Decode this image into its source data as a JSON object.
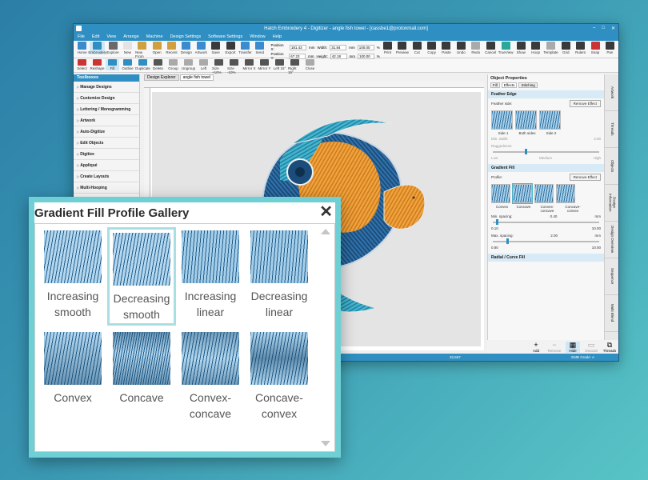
{
  "window": {
    "title": "Hatch Embroidery 4 - Digitizer - angle fish towel - [cassbe1@protonmail.com]"
  },
  "menu": [
    "File",
    "Edit",
    "View",
    "Arrange",
    "Machine",
    "Design Settings",
    "Software Settings",
    "Window",
    "Help"
  ],
  "ribbon": {
    "top_buttons": [
      "Home",
      "Embroidery",
      "Explore",
      "New",
      "New From",
      "Open",
      "Recent",
      "Design",
      "Artwork",
      "Save",
      "Export",
      "Transfer",
      "Send",
      "Print",
      "Preview",
      "Cut",
      "Copy",
      "Paste",
      "Undo",
      "Redo",
      "Cancel",
      "TrueView",
      "Show",
      "Hoop",
      "Template",
      "Grid",
      "Rulers",
      "Snap",
      "Pan"
    ],
    "bottom_buttons": [
      "Select",
      "Reshape",
      "Fill",
      "Outline",
      "Duplicate",
      "Delete",
      "Group",
      "Ungroup",
      "Left",
      "Size +10%",
      "Size -10%",
      "Mirror X",
      "Mirror Y",
      "Left 15°",
      "Right 15°",
      "Close"
    ],
    "position_x_label": "Position X:",
    "position_x": "181.43",
    "position_y_label": "Position Y:",
    "position_y": "67.23",
    "width_label": "Width:",
    "width": "31.84",
    "height_label": "Height:",
    "height": "42.18",
    "pct_w": "100.00",
    "pct_h": "100.00",
    "unit": "mm",
    "pct_unit": "%"
  },
  "tabs": [
    "Design Explorer",
    "angle fish towel"
  ],
  "toolbox": {
    "title": "Toolboxes",
    "items": [
      "Manage Designs",
      "Customize Design",
      "Lettering / Monogramming",
      "Artwork",
      "Auto-Digitize",
      "Edit Objects",
      "Digitize",
      "Appliqué",
      "Create Layouts",
      "Multi-Hooping"
    ]
  },
  "properties": {
    "title": "Object Properties",
    "tabs": [
      "Fill",
      "Effects",
      "Stitching"
    ],
    "feather_edge": "Feather Edge",
    "feather_side_label": "Feather side:",
    "remove_effect": "Remove Effect",
    "feather_options": [
      "Side 1",
      "Both sides",
      "Side 2"
    ],
    "min_width_label": "Min. width:",
    "min_width": "3.00",
    "raggedness_label": "Raggedness:",
    "ragged_scale": [
      "Low",
      "Medium",
      "High"
    ],
    "gradient_fill": "Gradient Fill",
    "profile_label": "Profile:",
    "profiles": [
      "Convex",
      "Concave",
      "Convex-concave",
      "Concave-convex"
    ],
    "min_spacing_label": "Min. spacing:",
    "min_spacing": "0.40",
    "max_spacing_label": "Max. spacing:",
    "max_spacing": "2.00",
    "range_min_low": "0.10",
    "range_min_high": "10.00",
    "range_max_low": "0.80",
    "range_max_high": "10.00",
    "radial_curve": "Radial / Curve Fill",
    "mm": "mm"
  },
  "side_tabs": [
    "Artwork",
    "Threads",
    "Objects",
    "Design Information",
    "Design Overview",
    "Sequence",
    "Multi Blend"
  ],
  "bottom_actions": [
    "Add",
    "Remove",
    "Hide",
    "Discard",
    "Threads"
  ],
  "status": {
    "stitch_count": "32,557",
    "emb_grade": "EMB Grade: A"
  },
  "gallery": {
    "title": "Gradient Fill Profile Gallery",
    "close_icon": "close-icon",
    "items": [
      {
        "label": "Increasing\nsmooth",
        "selected": false
      },
      {
        "label": "Decreasing\nsmooth",
        "selected": true
      },
      {
        "label": "Increasing\nlinear",
        "selected": false
      },
      {
        "label": "Decreasing\nlinear",
        "selected": false
      },
      {
        "label": "Convex",
        "selected": false
      },
      {
        "label": "Concave",
        "selected": false
      },
      {
        "label": "Convex-\nconcave",
        "selected": false
      },
      {
        "label": "Concave-\nconvex",
        "selected": false
      }
    ]
  },
  "colors": {
    "accent": "#2f8fc2",
    "gallery_border": "#6ed0d4",
    "stitch_dark": "#1e5d8c",
    "stitch_light": "#b5d8ef"
  }
}
